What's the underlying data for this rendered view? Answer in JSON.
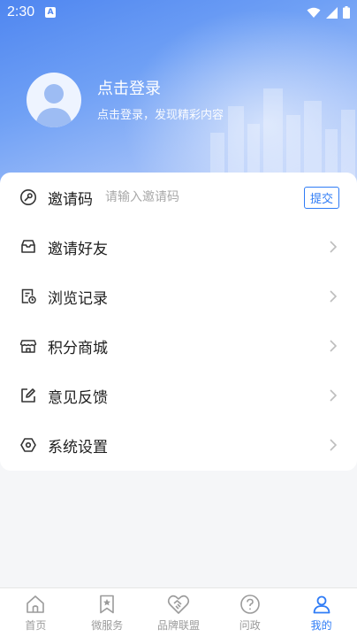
{
  "status_bar": {
    "time": "2:30",
    "badge": "A"
  },
  "profile": {
    "title": "点击登录",
    "subtitle": "点击登录，发现精彩内容"
  },
  "invite": {
    "label": "邀请码",
    "placeholder": "请输入邀请码",
    "value": "",
    "submit_label": "提交"
  },
  "menu": [
    {
      "label": "邀请好友",
      "icon": "envelope-icon"
    },
    {
      "label": "浏览记录",
      "icon": "history-doc-icon"
    },
    {
      "label": "积分商城",
      "icon": "store-icon"
    },
    {
      "label": "意见反馈",
      "icon": "edit-icon"
    },
    {
      "label": "系统设置",
      "icon": "settings-hex-icon"
    }
  ],
  "tabs": [
    {
      "label": "首页",
      "icon": "home-icon"
    },
    {
      "label": "微服务",
      "icon": "bookmark-star-icon"
    },
    {
      "label": "品牌联盟",
      "icon": "handshake-heart-icon"
    },
    {
      "label": "问政",
      "icon": "question-icon"
    },
    {
      "label": "我的",
      "icon": "user-icon",
      "active": true
    }
  ],
  "colors": {
    "accent": "#2f7cf6",
    "hero_start": "#4f86f0",
    "hero_end": "#c9d9fb",
    "tab_inactive": "#9b9b9b"
  }
}
